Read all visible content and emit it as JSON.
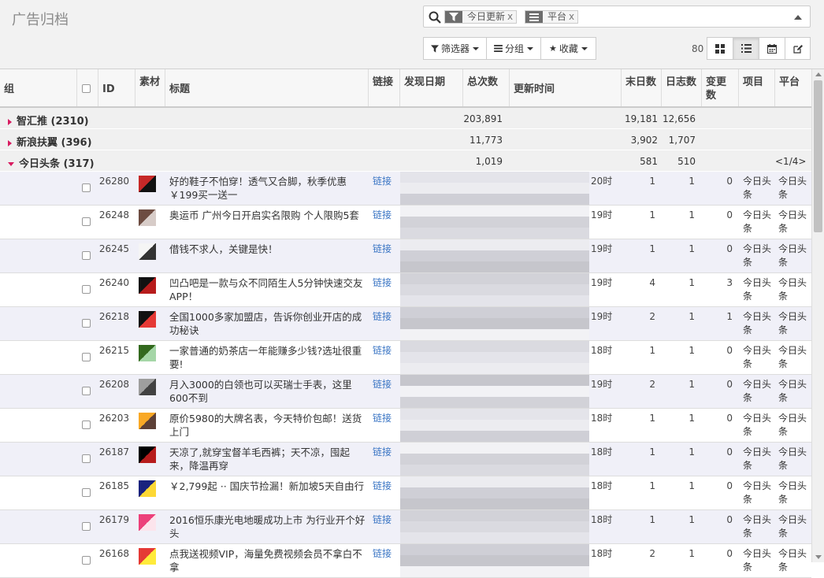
{
  "page": {
    "title": "广告归档"
  },
  "search": {
    "facets": [
      {
        "icon": "filter-icon",
        "label": "今日更新",
        "remove": "x"
      },
      {
        "icon": "list-icon",
        "label": "平台",
        "remove": "x"
      }
    ]
  },
  "toolbar": {
    "filters_label": "筛选器",
    "group_label": "分组",
    "favorites_label": "收藏",
    "record_count": "80",
    "view_active": "list"
  },
  "colors": {
    "accent": "#d81b60",
    "link": "#3a75c4",
    "facet_icon_bg": "#6d6d6d"
  },
  "table": {
    "headers": {
      "group": "组",
      "id": "ID",
      "material": "素材",
      "title": "标题",
      "link": "链接",
      "found_date": "发现日期",
      "total": "总次数",
      "updated": "更新时间",
      "last_day": "末日数",
      "log": "日志数",
      "change": "变更数",
      "project": "项目",
      "platform": "平台"
    },
    "groups": [
      {
        "name": "智汇推 (2310)",
        "expanded": false,
        "total": "203,891",
        "last_day": "19,181",
        "log": "12,656",
        "pager": ""
      },
      {
        "name": "新浪扶翼 (396)",
        "expanded": false,
        "total": "11,773",
        "last_day": "3,902",
        "log": "1,707",
        "pager": ""
      },
      {
        "name": "今日头条 (317)",
        "expanded": true,
        "total": "1,019",
        "last_day": "581",
        "log": "510",
        "pager": "<1/4>"
      }
    ],
    "rows": [
      {
        "id": "26280",
        "title": "好的鞋子不怕穿！透气又合脚，秋季优惠￥199买一送一",
        "link": "链接",
        "time": "20时",
        "last_day": "1",
        "log": "1",
        "change": "0",
        "project": "今日头条",
        "platform": "今日头条"
      },
      {
        "id": "26248",
        "title": "奥运币 广州今日开启实名限购 个人限购5套",
        "link": "链接",
        "time": "19时",
        "last_day": "1",
        "log": "1",
        "change": "0",
        "project": "今日头条",
        "platform": "今日头条"
      },
      {
        "id": "26245",
        "title": "借钱不求人，关键是快！",
        "link": "链接",
        "time": "19时",
        "last_day": "1",
        "log": "1",
        "change": "0",
        "project": "今日头条",
        "platform": "今日头条"
      },
      {
        "id": "26240",
        "title": "凹凸吧是一款与众不同陌生人5分钟快速交友APP！",
        "link": "链接",
        "time": "19时",
        "last_day": "4",
        "log": "1",
        "change": "3",
        "project": "今日头条",
        "platform": "今日头条"
      },
      {
        "id": "26218",
        "title": "全国1000多家加盟店，告诉你创业开店的成功秘诀",
        "link": "链接",
        "time": "19时",
        "last_day": "2",
        "log": "1",
        "change": "1",
        "project": "今日头条",
        "platform": "今日头条"
      },
      {
        "id": "26215",
        "title": "一家普通的奶茶店一年能赚多少钱?选址很重要!",
        "link": "链接",
        "time": "18时",
        "last_day": "1",
        "log": "1",
        "change": "0",
        "project": "今日头条",
        "platform": "今日头条"
      },
      {
        "id": "26208",
        "title": "月入3000的白领也可以买瑞士手表，这里600不到",
        "link": "链接",
        "time": "19时",
        "last_day": "2",
        "log": "1",
        "change": "0",
        "project": "今日头条",
        "platform": "今日头条"
      },
      {
        "id": "26203",
        "title": "原价5980的大牌名表，今天特价包邮！送货上门",
        "link": "链接",
        "time": "18时",
        "last_day": "1",
        "log": "1",
        "change": "0",
        "project": "今日头条",
        "platform": "今日头条"
      },
      {
        "id": "26187",
        "title": "天凉了,就穿宝督羊毛西裤；天不凉，囤起来，降温再穿",
        "link": "链接",
        "time": "18时",
        "last_day": "1",
        "log": "1",
        "change": "0",
        "project": "今日头条",
        "platform": "今日头条"
      },
      {
        "id": "26185",
        "title": "￥2,799起 ·· 国庆节捡漏！新加坡5天自由行",
        "link": "链接",
        "time": "18时",
        "last_day": "1",
        "log": "1",
        "change": "0",
        "project": "今日头条",
        "platform": "今日头条"
      },
      {
        "id": "26179",
        "title": "2016恒乐康光电地暖成功上市 为行业开个好头",
        "link": "链接",
        "time": "18时",
        "last_day": "1",
        "log": "1",
        "change": "0",
        "project": "今日头条",
        "platform": "今日头条"
      },
      {
        "id": "26168",
        "title": "点我送视频VIP，海量免费视频会员不拿白不拿",
        "link": "链接",
        "time": "18时",
        "last_day": "2",
        "log": "1",
        "change": "0",
        "project": "今日头条",
        "platform": "今日头条"
      }
    ]
  }
}
